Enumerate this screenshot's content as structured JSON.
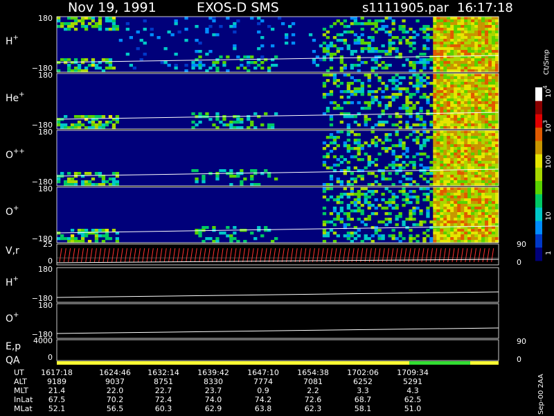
{
  "header": {
    "date": "Nov 19, 1991",
    "instrument": "EXOS-D SMS",
    "file": "s1111905.par",
    "time": "16:17:18"
  },
  "colorbar": {
    "label": "Ct/Smp",
    "ticks": [
      "1",
      "10",
      "100",
      "10",
      "10"
    ],
    "tick_exponents": [
      "",
      "",
      "",
      "3",
      "4"
    ],
    "colors": [
      "#00007a",
      "#0038c8",
      "#008cff",
      "#00c8c8",
      "#00c864",
      "#5ad200",
      "#a8d800",
      "#e6e600",
      "#c89600",
      "#e05a00",
      "#e00000",
      "#8a0000",
      "#ffffff"
    ]
  },
  "chart_data": {
    "type": "heatmap",
    "title": "Nov 19, 1991   EXOS-D SMS",
    "xlabel": "UT",
    "spectrogram_panels": [
      {
        "label": "H",
        "sup": "+",
        "ytop": "180",
        "ybottom": "−180"
      },
      {
        "label": "He",
        "sup": "+",
        "ytop": "180",
        "ybottom": "−180"
      },
      {
        "label": "O",
        "sup": "++",
        "ytop": "180",
        "ybottom": "−180"
      },
      {
        "label": "O",
        "sup": "+",
        "ytop": "180",
        "ybottom": "−180"
      }
    ],
    "vr_panel": {
      "label": "V,r",
      "ytop": "25",
      "ybottom": "0",
      "right_top": "90",
      "right_bottom": "0"
    },
    "line_panels": [
      {
        "label": "H",
        "sup": "+",
        "ytop": "180",
        "ybottom": "−180"
      },
      {
        "label": "O",
        "sup": "+",
        "ytop": "180",
        "ybottom": "−180"
      }
    ],
    "ep_panel": {
      "label": "E,p",
      "ytop": "4000",
      "ybottom": "0",
      "right_top": "90",
      "right_bottom": "0"
    },
    "qa_panel": {
      "label": "QA"
    },
    "orbit_table": {
      "rows": [
        {
          "name": "UT",
          "values": [
            "1617:18",
            "1624:46",
            "1632:14",
            "1639:42",
            "1647:10",
            "1654:38",
            "1702:06",
            "1709:34"
          ]
        },
        {
          "name": "ALT",
          "values": [
            "9189",
            "9037",
            "8751",
            "8330",
            "7774",
            "7081",
            "6252",
            "5291"
          ]
        },
        {
          "name": "MLT",
          "values": [
            "21.4",
            "22.0",
            "22.7",
            "23.7",
            "0.9",
            "2.2",
            "3.3",
            "4.3"
          ]
        },
        {
          "name": "InLat",
          "values": [
            "67.5",
            "70.2",
            "72.4",
            "74.0",
            "74.2",
            "72.6",
            "68.7",
            "62.5"
          ]
        },
        {
          "name": "MLat",
          "values": [
            "52.1",
            "56.5",
            "60.3",
            "62.9",
            "63.8",
            "62.3",
            "58.1",
            "51.0"
          ]
        }
      ]
    },
    "footer_note": "Sep-00 2AA"
  }
}
